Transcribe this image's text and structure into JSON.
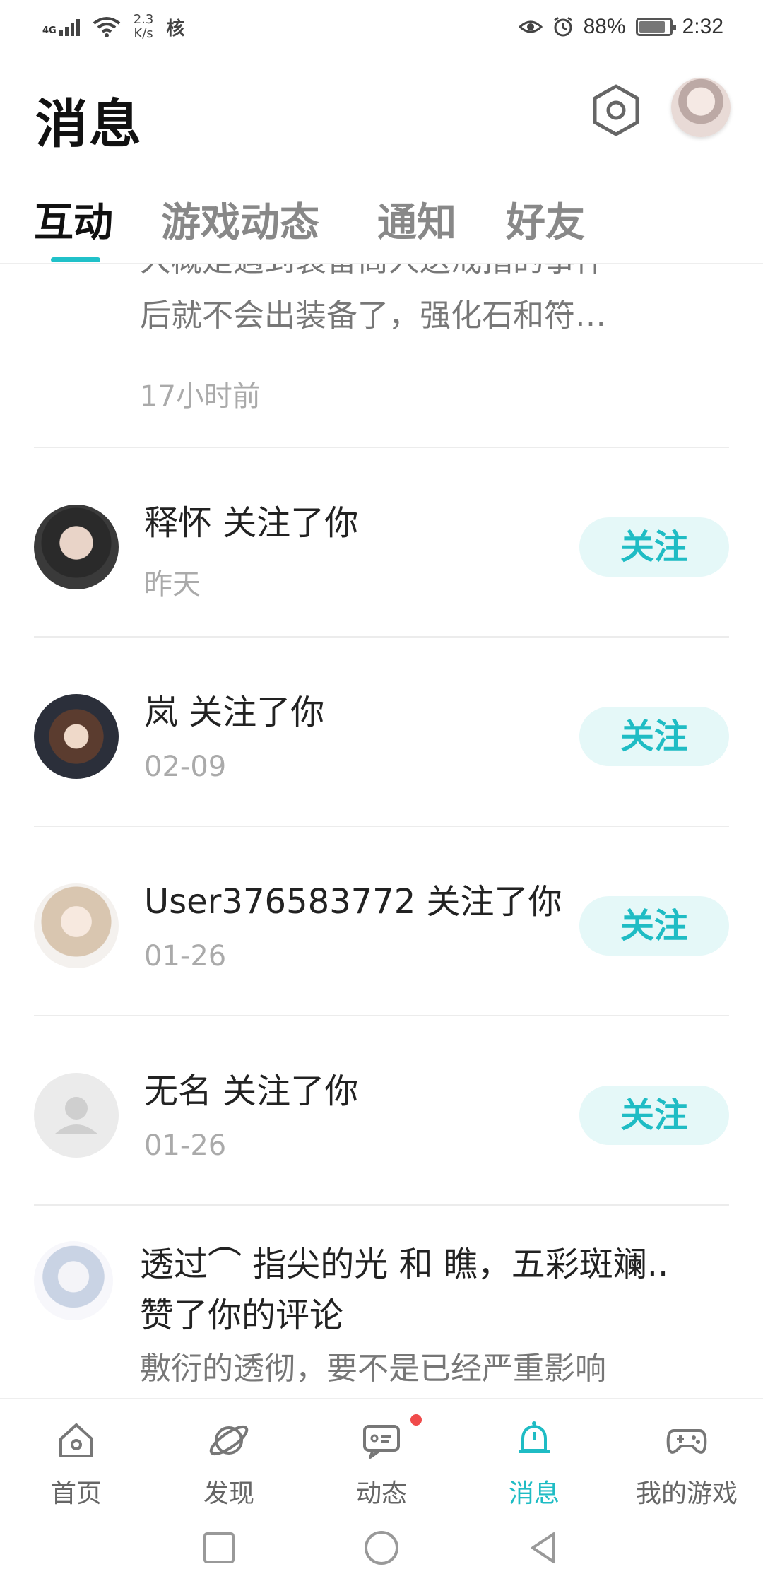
{
  "status_bar": {
    "network": "4G",
    "speed": "2.3\nK/s",
    "carrier_icon": "核",
    "battery": "88%",
    "battery_level_percent": 88,
    "time": "2:32"
  },
  "header": {
    "title": "消息"
  },
  "tabs": [
    {
      "label": "互动",
      "active": true
    },
    {
      "label": "游戏动态",
      "active": false
    },
    {
      "label": "通知",
      "active": false
    },
    {
      "label": "好友",
      "active": false
    }
  ],
  "feed": {
    "partial_top": {
      "line1": "大概是遇到装备商人送戒指的事件",
      "line2": "后就不会出装备了，强化石和符…",
      "time": "17小时前"
    },
    "follows": [
      {
        "title": "释怀 关注了你",
        "time": "昨天",
        "button": "关注"
      },
      {
        "title": "岚 关注了你",
        "time": "02-09",
        "button": "关注"
      },
      {
        "title": "User376583772 关注了你",
        "time": "01-26",
        "button": "关注"
      },
      {
        "title": "无名 关注了你",
        "time": "01-26",
        "button": "关注"
      }
    ],
    "like_item": {
      "title": "透过⌒ 指尖的光 和 瞧，五彩斑斓..",
      "subtitle": "赞了你的评论",
      "quote": "敷衍的透彻，要不是已经严重影响"
    }
  },
  "bottom_nav": [
    {
      "label": "首页",
      "icon": "home-icon",
      "active": false
    },
    {
      "label": "发现",
      "icon": "discover-planet-icon",
      "active": false
    },
    {
      "label": "动态",
      "icon": "feed-chat-icon",
      "active": false,
      "badge": true
    },
    {
      "label": "消息",
      "icon": "bell-icon",
      "active": true
    },
    {
      "label": "我的游戏",
      "icon": "gamepad-icon",
      "active": false
    }
  ],
  "colors": {
    "accent": "#1fbcc4",
    "follow_bg": "#e5f8f8",
    "badge": "#f04b4b"
  }
}
